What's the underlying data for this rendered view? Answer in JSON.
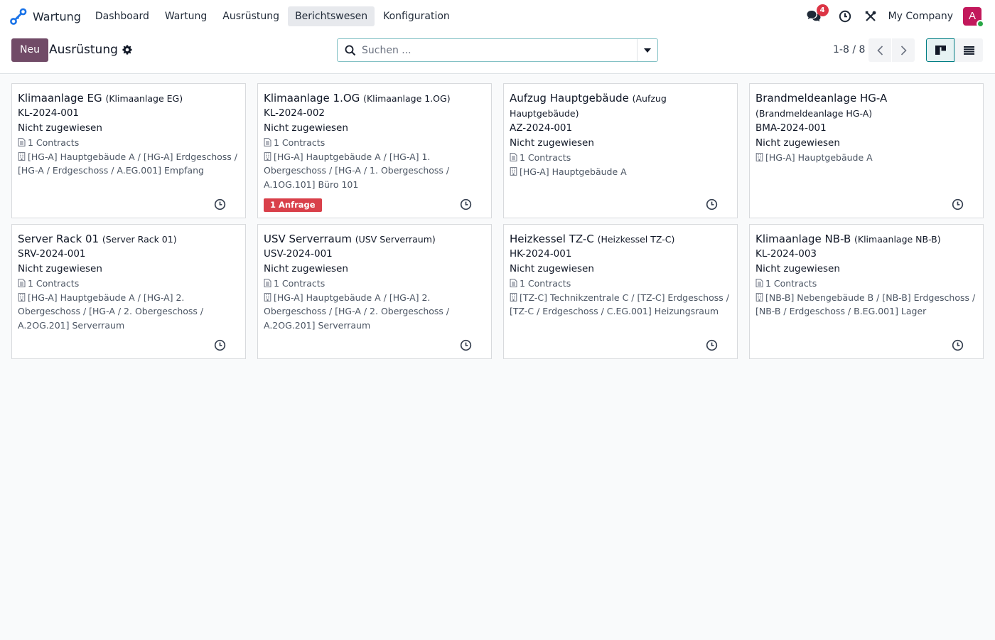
{
  "app": {
    "name": "Wartung",
    "brand_color": "#714b67"
  },
  "menu": [
    {
      "label": "Dashboard",
      "active": false
    },
    {
      "label": "Wartung",
      "active": false
    },
    {
      "label": "Ausrüstung",
      "active": false
    },
    {
      "label": "Berichtswesen",
      "active": true
    },
    {
      "label": "Konfiguration",
      "active": false
    }
  ],
  "nav": {
    "messages_icon": "chat-icon",
    "messages_count": "4",
    "activity_icon": "clock-icon",
    "tools_icon": "tools-icon",
    "company": "My Company",
    "avatar_letter": "A"
  },
  "control": {
    "new_label": "Neu",
    "title": "Ausrüstung",
    "search_placeholder": "Suchen ...",
    "pager": "1-8 / 8"
  },
  "cards": [
    {
      "name": "Klimaanlage EG",
      "sub": "(Klimaanlage EG)",
      "ref": "KL-2024-001",
      "assign": "Nicht zugewiesen",
      "contracts": "1 Contracts",
      "location": "[HG-A] Hauptgebäude A / [HG-A] Erdgeschoss / [HG-A / Erdgeschoss / A.EG.001] Empfang",
      "request": ""
    },
    {
      "name": "Klimaanlage 1.OG",
      "sub": "(Klimaanlage 1.OG)",
      "ref": "KL-2024-002",
      "assign": "Nicht zugewiesen",
      "contracts": "1 Contracts",
      "location": "[HG-A] Hauptgebäude A / [HG-A] 1. Obergeschoss / [HG-A / 1. Obergeschoss / A.1OG.101] Büro 101",
      "request": "1 Anfrage"
    },
    {
      "name": "Aufzug Hauptgebäude",
      "sub": "(Aufzug Hauptgebäude)",
      "ref": "AZ-2024-001",
      "assign": "Nicht zugewiesen",
      "contracts": "1 Contracts",
      "location": "[HG-A] Hauptgebäude A",
      "request": ""
    },
    {
      "name": "Brandmeldeanlage HG-A",
      "sub": "(Brandmeldeanlage HG-A)",
      "ref": "BMA-2024-001",
      "assign": "Nicht zugewiesen",
      "contracts": "",
      "location": "[HG-A] Hauptgebäude A",
      "request": ""
    },
    {
      "name": "Server Rack 01",
      "sub": "(Server Rack 01)",
      "ref": "SRV-2024-001",
      "assign": "Nicht zugewiesen",
      "contracts": "1 Contracts",
      "location": "[HG-A] Hauptgebäude A / [HG-A] 2. Obergeschoss / [HG-A / 2. Obergeschoss / A.2OG.201] Serverraum",
      "request": ""
    },
    {
      "name": "USV Serverraum",
      "sub": "(USV Serverraum)",
      "ref": "USV-2024-001",
      "assign": "Nicht zugewiesen",
      "contracts": "1 Contracts",
      "location": "[HG-A] Hauptgebäude A / [HG-A] 2. Obergeschoss / [HG-A / 2. Obergeschoss / A.2OG.201] Serverraum",
      "request": ""
    },
    {
      "name": "Heizkessel TZ-C",
      "sub": "(Heizkessel TZ-C)",
      "ref": "HK-2024-001",
      "assign": "Nicht zugewiesen",
      "contracts": "1 Contracts",
      "location": "[TZ-C] Technikzentrale C / [TZ-C] Erdgeschoss / [TZ-C / Erdgeschoss / C.EG.001] Heizungsraum",
      "request": ""
    },
    {
      "name": "Klimaanlage NB-B",
      "sub": "(Klimaanlage NB-B)",
      "ref": "KL-2024-003",
      "assign": "Nicht zugewiesen",
      "contracts": "1 Contracts",
      "location": "[NB-B] Nebengebäude B / [NB-B] Erdgeschoss / [NB-B / Erdgeschoss / B.EG.001] Lager",
      "request": ""
    }
  ]
}
